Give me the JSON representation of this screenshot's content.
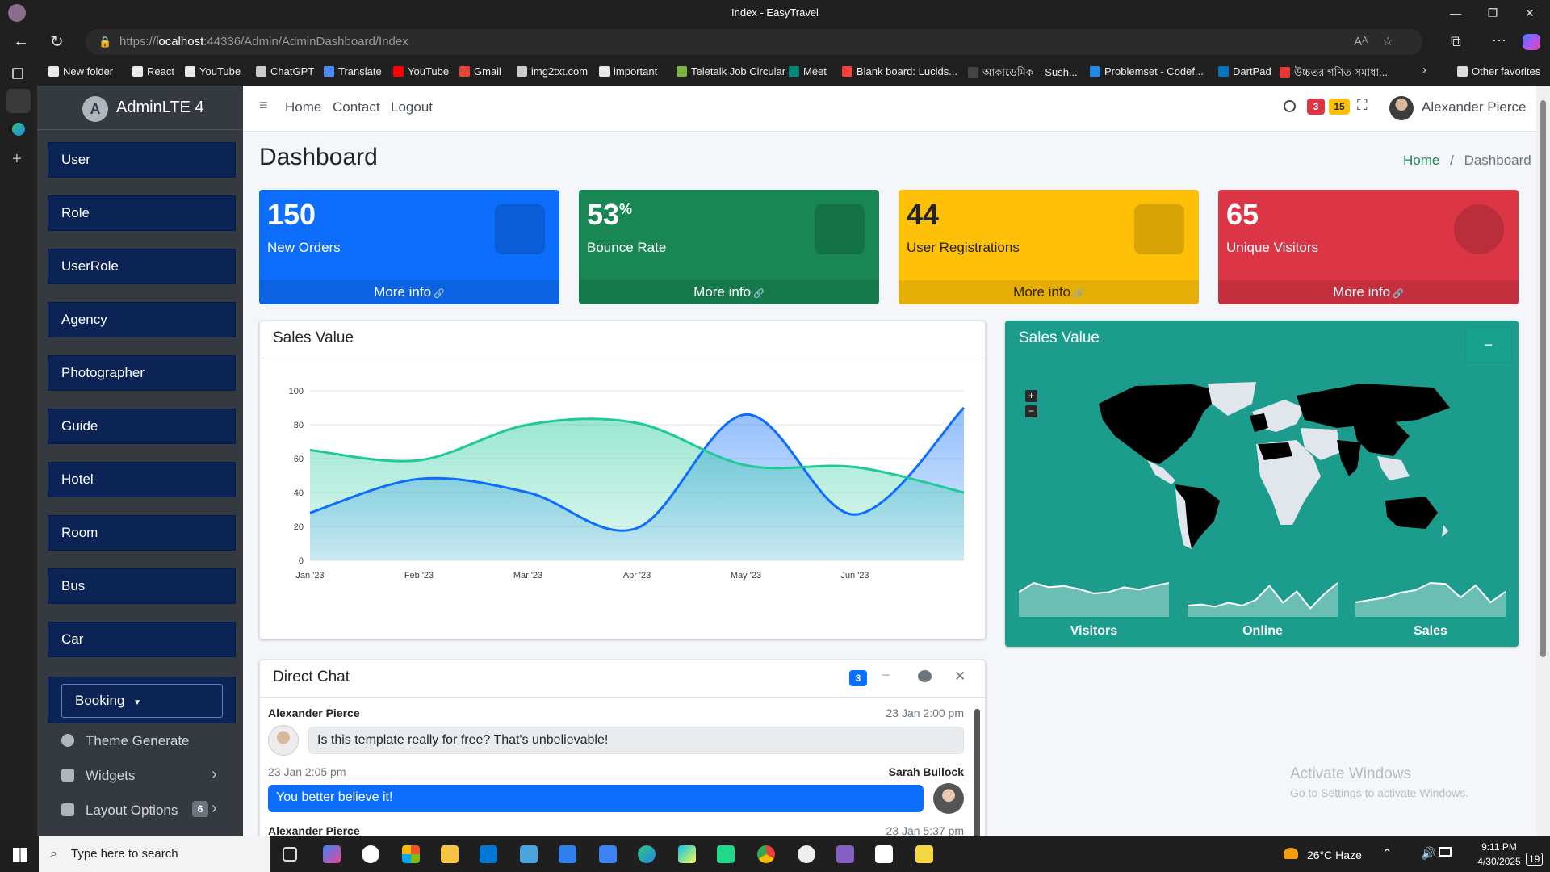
{
  "browser": {
    "tab_title": "Index - EasyTravel",
    "url_prefix": "https://",
    "url_host": "localhost",
    "url_rest": ":44336/Admin/AdminDashboard/Index",
    "bookmarks": [
      {
        "label": "New folder",
        "color": "#e8e8e8"
      },
      {
        "label": "React",
        "color": "#e8e8e8"
      },
      {
        "label": "YouTube",
        "color": "#e8e8e8"
      },
      {
        "label": "ChatGPT",
        "color": "#cccccc"
      },
      {
        "label": "Translate",
        "color": "#4a8af4"
      },
      {
        "label": "YouTube",
        "color": "#ff0000"
      },
      {
        "label": "Gmail",
        "color": "#ea4335"
      },
      {
        "label": "img2txt.com",
        "color": "#cccccc"
      },
      {
        "label": "important",
        "color": "#e8e8e8"
      },
      {
        "label": "Teletalk Job Circular",
        "color": "#7cb342"
      },
      {
        "label": "Meet",
        "color": "#00897b"
      },
      {
        "label": "Blank board: Lucids...",
        "color": "#f44336"
      },
      {
        "label": "আকাডেমিক – Sush...",
        "color": "#444444"
      },
      {
        "label": "Problemset - Codef...",
        "color": "#1e88e5"
      },
      {
        "label": "DartPad",
        "color": "#0175c2"
      },
      {
        "label": "উচ্চতর গণিত সমাধা...",
        "color": "#e53935"
      }
    ],
    "other_favorites": "Other favorites"
  },
  "sidebar": {
    "brand": "AdminLTE 4",
    "logo_letter": "A",
    "buttons": [
      "User",
      "Role",
      "UserRole",
      "Agency",
      "Photographer",
      "Guide",
      "Hotel",
      "Room",
      "Bus",
      "Car"
    ],
    "booking_label": "Booking",
    "items": [
      {
        "label": "Theme Generate"
      },
      {
        "label": "Widgets"
      },
      {
        "label": "Layout Options",
        "badge": "6"
      }
    ]
  },
  "topnav": {
    "links": [
      "Home",
      "Contact",
      "Logout"
    ],
    "badge_red": "3",
    "badge_yellow": "15",
    "user_name": "Alexander Pierce"
  },
  "page": {
    "title": "Dashboard",
    "breadcrumb_home": "Home",
    "breadcrumb_current": "Dashboard",
    "breadcrumb_sep": "/"
  },
  "stats": [
    {
      "value": "150",
      "sup": "",
      "label": "New Orders",
      "more": "More info",
      "color": "#0d6efd"
    },
    {
      "value": "53",
      "sup": "%",
      "label": "Bounce Rate",
      "more": "More info",
      "color": "#198754"
    },
    {
      "value": "44",
      "sup": "",
      "label": "User Registrations",
      "more": "More info",
      "color": "#ffc107"
    },
    {
      "value": "65",
      "sup": "",
      "label": "Unique Visitors",
      "more": "More info",
      "color": "#dc3545"
    }
  ],
  "sales_card": {
    "title": "Sales Value"
  },
  "map_card": {
    "title": "Sales Value",
    "minus": "−",
    "sparklines": [
      {
        "label": "Visitors",
        "values": [
          40,
          55,
          48,
          50,
          45,
          38,
          40,
          48,
          44,
          50,
          55
        ]
      },
      {
        "label": "Online",
        "values": [
          20,
          22,
          18,
          25,
          20,
          30,
          55,
          25,
          45,
          15,
          40,
          60
        ]
      },
      {
        "label": "Sales",
        "values": [
          30,
          35,
          40,
          50,
          55,
          70,
          68,
          40,
          65,
          30,
          52
        ]
      }
    ]
  },
  "chat": {
    "title": "Direct Chat",
    "badge": "3",
    "messages": [
      {
        "name": "Alexander Pierce",
        "time": "23 Jan 2:00 pm",
        "text": "Is this template really for free? That's unbelievable!",
        "side": "left"
      },
      {
        "name": "Sarah Bullock",
        "time": "23 Jan 2:05 pm",
        "text": "You better believe it!",
        "side": "right"
      },
      {
        "name": "Alexander Pierce",
        "time": "23 Jan 5:37 pm",
        "text": "",
        "side": "left"
      }
    ]
  },
  "watermark": {
    "line1": "Activate Windows",
    "line2": "Go to Settings to activate Windows."
  },
  "taskbar": {
    "search_placeholder": "Type here to search",
    "weather": "26°C  Haze",
    "time": "9:11 PM",
    "date": "4/30/2025",
    "notif": "19"
  },
  "chart_data": {
    "type": "area",
    "categories": [
      "Jan '23",
      "Feb '23",
      "Mar '23",
      "Apr '23",
      "May '23",
      "Jun '23"
    ],
    "x": [
      "2023-01-01",
      "2023-02-01",
      "2023-03-01",
      "2023-04-01",
      "2023-05-01",
      "2023-06-01",
      "2023-07-01"
    ],
    "series": [
      {
        "values": [
          28,
          48,
          40,
          19,
          86,
          27,
          90
        ],
        "color": "#0d6efd"
      },
      {
        "values": [
          65,
          59,
          80,
          81,
          56,
          55,
          40
        ],
        "color": "#20c997"
      }
    ],
    "ylim": [
      0,
      100
    ],
    "yticks": [
      0,
      20,
      40,
      60,
      80,
      100
    ],
    "grid": true
  }
}
